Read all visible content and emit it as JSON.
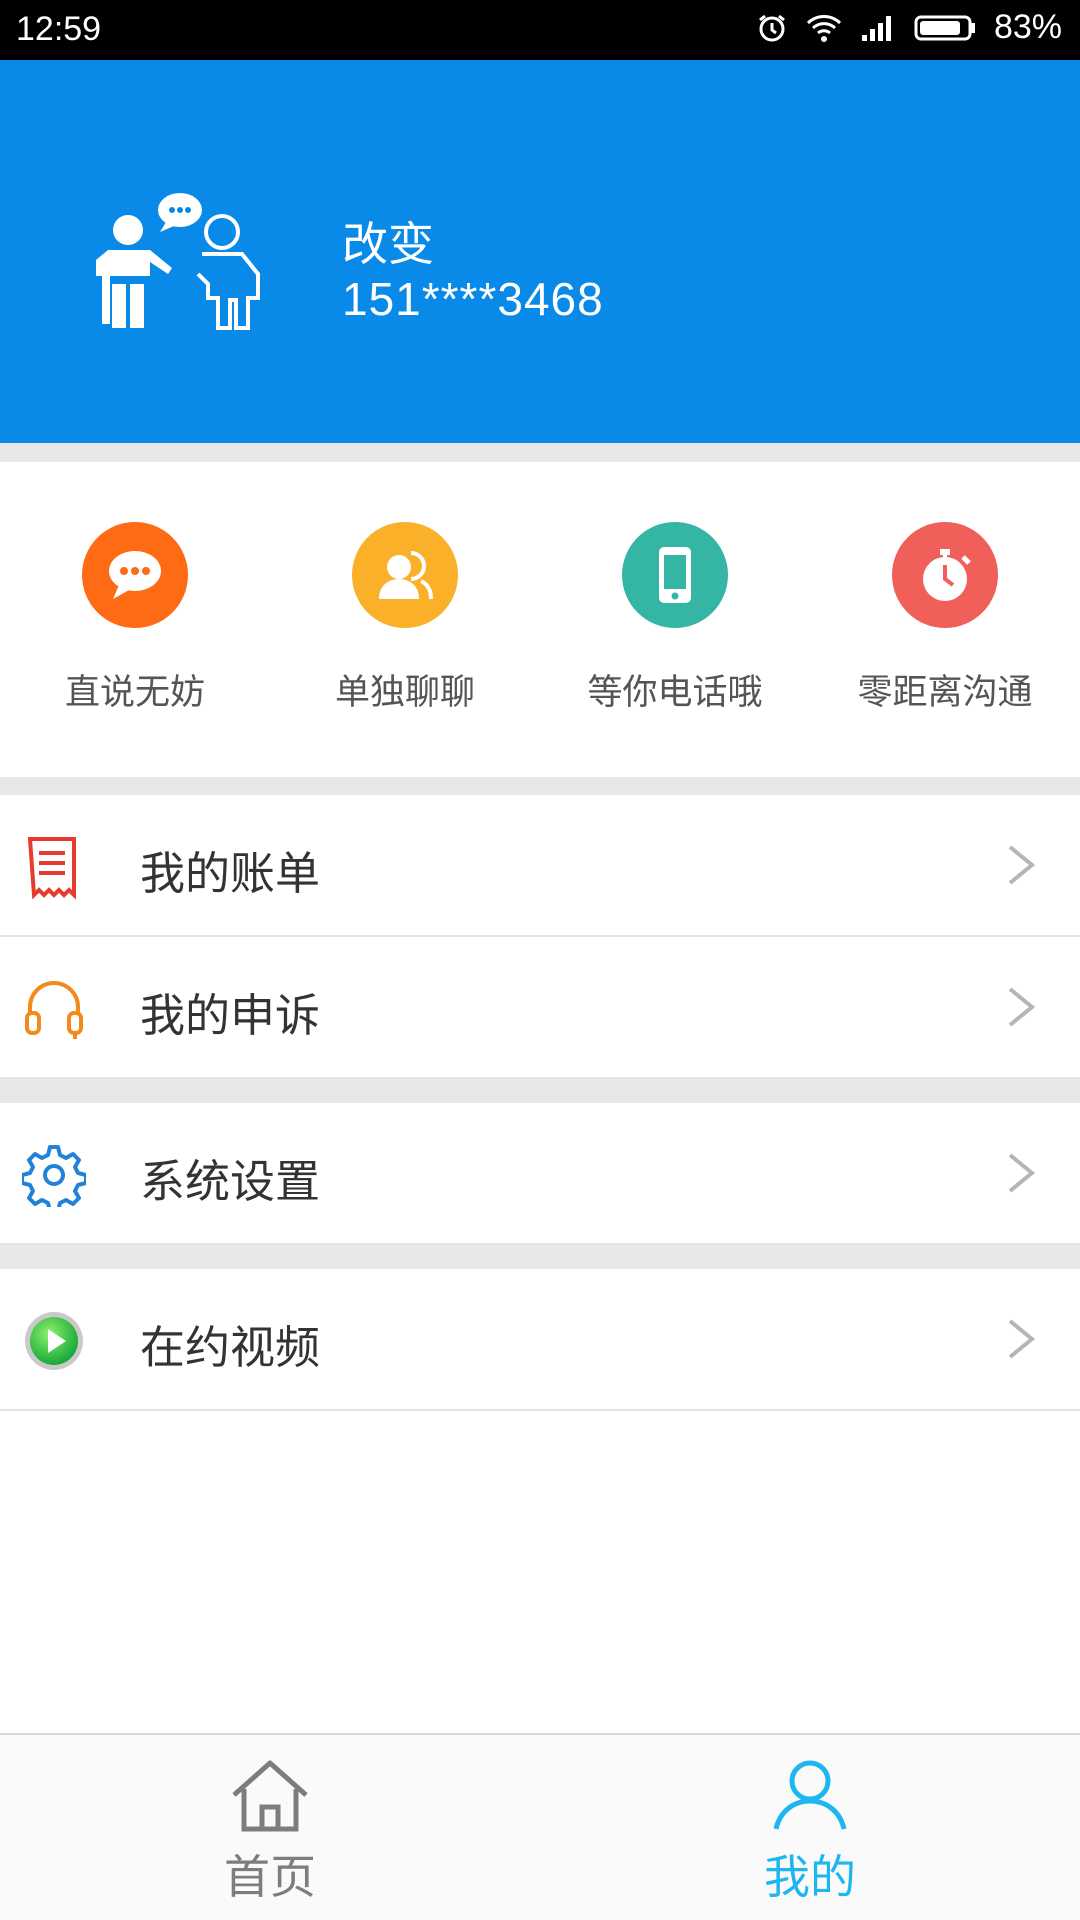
{
  "status_bar": {
    "time": "12:59",
    "battery": "83%"
  },
  "profile": {
    "name": "改变",
    "phone": "151****3468"
  },
  "quick_actions": [
    {
      "label": "直说无妨",
      "icon": "chat-bubble-icon",
      "color": "#ff6a14"
    },
    {
      "label": "单独聊聊",
      "icon": "contacts-icon",
      "color": "#fbb02a"
    },
    {
      "label": "等你电话哦",
      "icon": "phone-icon",
      "color": "#35b5a4"
    },
    {
      "label": "零距离沟通",
      "icon": "stopwatch-icon",
      "color": "#f05f5a"
    }
  ],
  "menu": [
    {
      "label": "我的账单",
      "icon": "bill-icon"
    },
    {
      "label": "我的申诉",
      "icon": "headset-icon"
    },
    {
      "label": "系统设置",
      "icon": "gear-icon"
    },
    {
      "label": "在约视频",
      "icon": "video-play-icon"
    }
  ],
  "bottom_nav": [
    {
      "label": "首页",
      "icon": "home-icon",
      "active": false
    },
    {
      "label": "我的",
      "icon": "person-icon",
      "active": true
    }
  ],
  "colors": {
    "header": "#0a8ae8",
    "active_nav": "#1eb6ef",
    "inactive_nav": "#7d7d7d"
  }
}
